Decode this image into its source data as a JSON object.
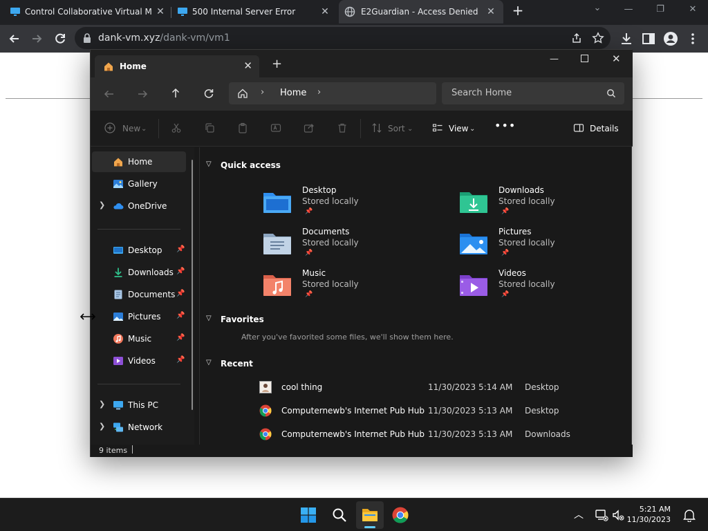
{
  "browser": {
    "tabs": [
      {
        "title": "Control Collaborative Virtual Ma",
        "active": false
      },
      {
        "title": "500 Internal Server Error",
        "active": false
      },
      {
        "title": "E2Guardian - Access Denied",
        "active": true
      }
    ],
    "url_host": "dank-vm.xyz",
    "url_path": "/dank-vm/vm1"
  },
  "explorer": {
    "tab_title": "Home",
    "breadcrumb": "Home",
    "search_placeholder": "Search Home",
    "commands": {
      "new": "New",
      "sort": "Sort",
      "view": "View",
      "details": "Details"
    },
    "sidebar": {
      "top": [
        {
          "label": "Home",
          "icon": "home-icon"
        },
        {
          "label": "Gallery",
          "icon": "gallery-icon"
        },
        {
          "label": "OneDrive",
          "icon": "onedrive-icon"
        }
      ],
      "pinned": [
        {
          "label": "Desktop",
          "icon": "desktop-icon"
        },
        {
          "label": "Downloads",
          "icon": "downloads-icon"
        },
        {
          "label": "Documents",
          "icon": "documents-icon"
        },
        {
          "label": "Pictures",
          "icon": "pictures-icon"
        },
        {
          "label": "Music",
          "icon": "music-icon"
        },
        {
          "label": "Videos",
          "icon": "videos-icon"
        }
      ],
      "bottom": [
        {
          "label": "This PC",
          "icon": "this-pc-icon"
        },
        {
          "label": "Network",
          "icon": "network-icon"
        }
      ]
    },
    "quick_access": {
      "title": "Quick access",
      "items": [
        {
          "name": "Desktop",
          "status": "Stored locally",
          "icon": "desktop-folder-icon"
        },
        {
          "name": "Downloads",
          "status": "Stored locally",
          "icon": "downloads-folder-icon"
        },
        {
          "name": "Documents",
          "status": "Stored locally",
          "icon": "documents-folder-icon"
        },
        {
          "name": "Pictures",
          "status": "Stored locally",
          "icon": "pictures-folder-icon"
        },
        {
          "name": "Music",
          "status": "Stored locally",
          "icon": "music-folder-icon"
        },
        {
          "name": "Videos",
          "status": "Stored locally",
          "icon": "videos-folder-icon"
        }
      ]
    },
    "favorites": {
      "title": "Favorites",
      "empty_text": "After you've favorited some files, we'll show them here."
    },
    "recent": {
      "title": "Recent",
      "items": [
        {
          "name": "cool thing",
          "date": "11/30/2023 5:14 AM",
          "location": "Desktop",
          "icon": "image-file-icon"
        },
        {
          "name": "Computernewb's Internet Pub Hub",
          "date": "11/30/2023 5:13 AM",
          "location": "Desktop",
          "icon": "chrome-icon"
        },
        {
          "name": "Computernewb's Internet Pub Hub",
          "date": "11/30/2023 5:13 AM",
          "location": "Downloads",
          "icon": "chrome-icon"
        }
      ]
    },
    "status": "9 items"
  },
  "taskbar": {
    "time": "5:21 AM",
    "date": "11/30/2023"
  }
}
